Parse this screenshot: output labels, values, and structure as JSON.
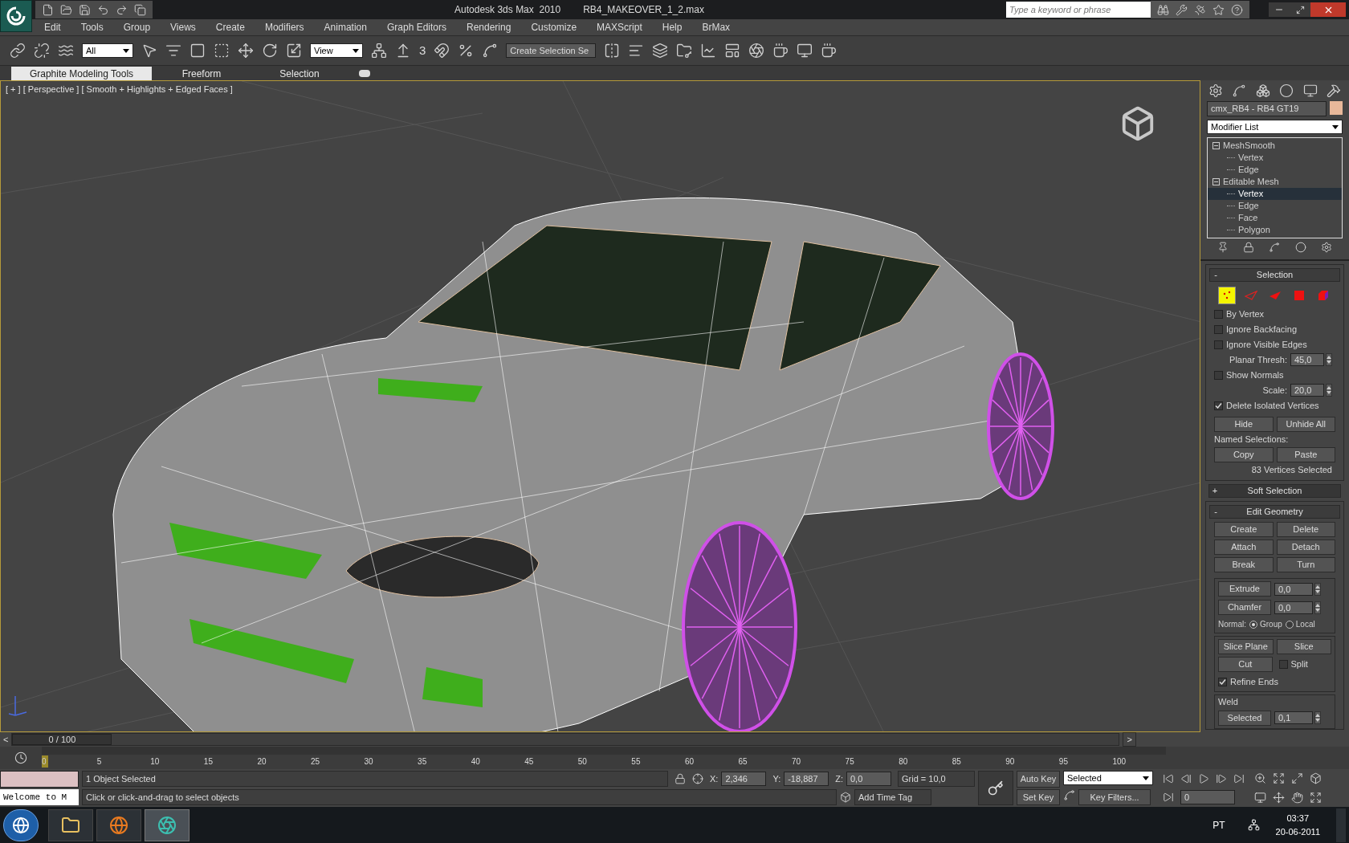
{
  "window": {
    "title": "Autodesk 3ds Max  2010",
    "file": "RB4_MAKEOVER_1_2.max"
  },
  "search": {
    "placeholder": "Type a keyword or phrase"
  },
  "menu": [
    "Edit",
    "Tools",
    "Group",
    "Views",
    "Create",
    "Modifiers",
    "Animation",
    "Graph Editors",
    "Rendering",
    "Customize",
    "MAXScript",
    "Help",
    "BrMax"
  ],
  "toolbar": {
    "selection_filter": "All",
    "reference_coord": "View",
    "snap_label": "3",
    "named_selection": "Create Selection Se"
  },
  "ribbon_tabs": [
    {
      "label": "Graphite Modeling Tools",
      "selected": true
    },
    {
      "label": "Freeform",
      "selected": false
    },
    {
      "label": "Selection",
      "selected": false
    }
  ],
  "viewport": {
    "label": "[ + ] [ Perspective ] [ Smooth + Highlights + Edged Faces ]"
  },
  "command_panel": {
    "object_name": "cmx_RB4 - RB4 GT19",
    "modifier_list": "Modifier List",
    "stack": [
      {
        "label": "MeshSmooth",
        "selected": false,
        "children": [
          {
            "label": "Vertex",
            "selected": false
          },
          {
            "label": "Edge",
            "selected": false
          }
        ]
      },
      {
        "label": "Editable Mesh",
        "selected": false,
        "children": [
          {
            "label": "Vertex",
            "selected": true
          },
          {
            "label": "Edge",
            "selected": false
          },
          {
            "label": "Face",
            "selected": false
          },
          {
            "label": "Polygon",
            "selected": false
          }
        ]
      }
    ],
    "rollouts": [
      {
        "kind": "selection",
        "toggle": "-",
        "title": "Selection",
        "expanded": true,
        "levels": [
          {
            "kind": "vertex",
            "selected": true
          },
          {
            "kind": "edge",
            "selected": false
          },
          {
            "kind": "face",
            "selected": false
          },
          {
            "kind": "polygon",
            "selected": false
          },
          {
            "kind": "element",
            "selected": false
          }
        ],
        "options": [
          {
            "kind": "check",
            "label": "By Vertex",
            "checked": false
          },
          {
            "kind": "check",
            "label": "Ignore Backfacing",
            "checked": false
          },
          {
            "kind": "check",
            "label": "Ignore Visible Edges",
            "checked": false
          },
          {
            "kind": "spinner",
            "label": "Planar Thresh:",
            "value": "45,0"
          },
          {
            "kind": "check",
            "label": "Show Normals",
            "checked": false
          },
          {
            "kind": "spinner",
            "label": "Scale:",
            "value": "20,0"
          },
          {
            "kind": "check",
            "label": "Delete Isolated Vertices",
            "checked": true
          }
        ],
        "buttons": [
          "Hide",
          "Unhide All"
        ],
        "named_label": "Named Selections:",
        "named_buttons": [
          "Copy",
          "Paste"
        ],
        "status": "83 Vertices Selected"
      },
      {
        "kind": "soft",
        "toggle": "+",
        "title": "Soft Selection",
        "expanded": false
      },
      {
        "kind": "geometry",
        "toggle": "-",
        "title": "Edit Geometry",
        "expanded": true,
        "buttons": [
          "Create",
          "Delete",
          "Attach",
          "Detach",
          "Break",
          "Turn"
        ],
        "spinners": [
          {
            "label": "Extrude",
            "value": "0,0"
          },
          {
            "label": "Chamfer",
            "value": "0,0"
          }
        ],
        "normal_label": "Normal:",
        "normal_options": [
          {
            "label": "Group",
            "selected": true
          },
          {
            "label": "Local",
            "selected": false
          }
        ],
        "slice_buttons": [
          "Slice Plane",
          "Slice"
        ],
        "cut": "Cut",
        "split": {
          "label": "Split",
          "checked": false
        },
        "refine": {
          "label": "Refine Ends",
          "checked": true
        },
        "weld": {
          "title": "Weld",
          "button": "Selected",
          "value": "0,1"
        }
      }
    ]
  },
  "timeline": {
    "position": "0 / 100",
    "prev": "<",
    "next": ">",
    "ticks": [
      "0",
      "5",
      "10",
      "15",
      "20",
      "25",
      "30",
      "35",
      "40",
      "45",
      "50",
      "55",
      "60",
      "65",
      "70",
      "75",
      "80",
      "85",
      "90",
      "95",
      "100"
    ]
  },
  "status": {
    "listener": "Welcome to M",
    "selection": "1 Object Selected",
    "prompt": "Click or click-and-drag to select objects",
    "coords": [
      {
        "label": "X:",
        "value": "2,346"
      },
      {
        "label": "Y:",
        "value": "-18,887"
      },
      {
        "label": "Z:",
        "value": "0,0"
      }
    ],
    "grid": "Grid = 10,0",
    "time_tag": "Add Time Tag",
    "auto_key": "Auto Key",
    "set_key": "Set Key",
    "key_mode": "Selected",
    "key_filters": "Key Filters...",
    "frame": "0"
  },
  "taskbar": {
    "language": "PT",
    "time": "03:37",
    "date": "20-06-2011"
  }
}
